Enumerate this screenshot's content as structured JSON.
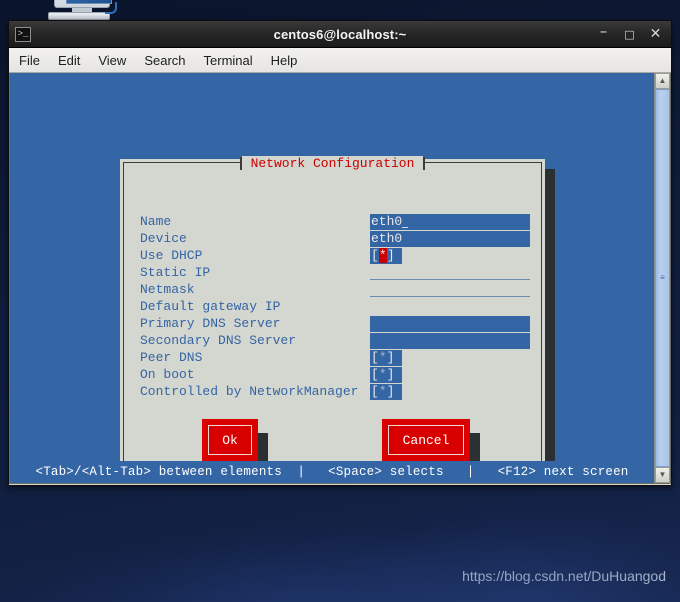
{
  "desktop": {
    "computer_icon_name": "computer-icon",
    "watermark": "https://blog.csdn.net/DuHuangod"
  },
  "window": {
    "title": "centos6@localhost:~",
    "terminal_icon": ">_",
    "buttons": {
      "minimize": "–",
      "maximize": "□",
      "close": "✕"
    },
    "menu": [
      {
        "label": "File"
      },
      {
        "label": "Edit"
      },
      {
        "label": "View"
      },
      {
        "label": "Search"
      },
      {
        "label": "Terminal"
      },
      {
        "label": "Help"
      }
    ]
  },
  "scrollbar": {
    "up_arrow": "▲",
    "down_arrow": "▼",
    "grip": "≡"
  },
  "dialog": {
    "title": "Network Configuration",
    "title_color": "#cc0000",
    "fields": [
      {
        "label": "Name",
        "type": "text",
        "value": "eth0",
        "cursor": true
      },
      {
        "label": "Device",
        "type": "text",
        "value": "eth0",
        "cursor": false
      },
      {
        "label": "Use DHCP",
        "type": "checkbox",
        "checked": true,
        "focused": true
      },
      {
        "label": "Static IP",
        "type": "underline",
        "value": ""
      },
      {
        "label": "Netmask",
        "type": "underline",
        "value": ""
      },
      {
        "label": "Default gateway IP",
        "type": "none",
        "value": ""
      },
      {
        "label": "Primary DNS Server",
        "type": "blank",
        "value": ""
      },
      {
        "label": "Secondary DNS Server",
        "type": "blank",
        "value": ""
      },
      {
        "label": "Peer DNS",
        "type": "checkbox",
        "checked": true,
        "focused": false
      },
      {
        "label": "On boot",
        "type": "checkbox",
        "checked": true,
        "focused": false
      },
      {
        "label": "Controlled by NetworkManager",
        "type": "checkbox",
        "checked": true,
        "focused": false
      }
    ],
    "buttons": {
      "ok": "Ok",
      "cancel": "Cancel"
    }
  },
  "statusbar": {
    "text": "<Tab>/<Alt-Tab> between elements  |   <Space> selects   |   <F12> next screen"
  },
  "colors": {
    "terminal_blue": "#3465a4",
    "dialog_gray": "#d4d6d0",
    "accent_red": "#cc0000",
    "button_red": "#d90000"
  }
}
